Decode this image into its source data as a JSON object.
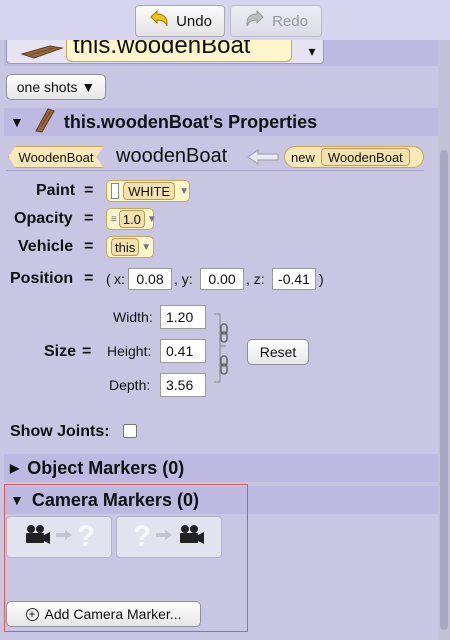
{
  "toolbar": {
    "undo_label": "Undo",
    "redo_label": "Redo"
  },
  "header": {
    "tile_text": "this.woodenBoat",
    "dropdown_arrow": "▾"
  },
  "one_shots": {
    "label": "one shots ▼"
  },
  "properties": {
    "title": "this.woodenBoat's Properties",
    "type_chip": "WoodenBoat",
    "instance_name": "woodenBoat",
    "new_label": "new",
    "new_type": "WoodenBoat",
    "paint": {
      "label": "Paint",
      "equals": "=",
      "value": "WHITE"
    },
    "opacity": {
      "label": "Opacity",
      "equals": "=",
      "value": "1.0"
    },
    "vehicle": {
      "label": "Vehicle",
      "equals": "=",
      "value": "this"
    },
    "position": {
      "label": "Position",
      "equals": "=",
      "open": "(",
      "x_label": "x:",
      "x": "0.08",
      "y_label": ", y:",
      "y": "0.00",
      "z_label": ", z:",
      "z": "-0.41",
      "close": ")"
    },
    "size": {
      "label": "Size",
      "equals": "=",
      "width_label": "Width:",
      "width": "1.20",
      "height_label": "Height:",
      "height": "0.41",
      "depth_label": "Depth:",
      "depth": "3.56",
      "reset_label": "Reset"
    },
    "show_joints": {
      "label": "Show Joints:",
      "checked": false
    }
  },
  "object_markers": {
    "label": "Object Markers (0)"
  },
  "camera_markers": {
    "label": "Camera Markers (0)",
    "add_button": "Add Camera Marker..."
  },
  "icons": {
    "undo": "undo-icon",
    "redo": "redo-icon",
    "boat": "wooden-boat-icon",
    "camera": "camera-icon",
    "arrow": "arrow-icon",
    "question": "question-icon",
    "add": "plus-icon"
  },
  "colors": {
    "panel": "#c9c6e3",
    "band": "#bdb9e0",
    "tile": "#fff6cc",
    "selection_outline": "#e05a5a"
  }
}
